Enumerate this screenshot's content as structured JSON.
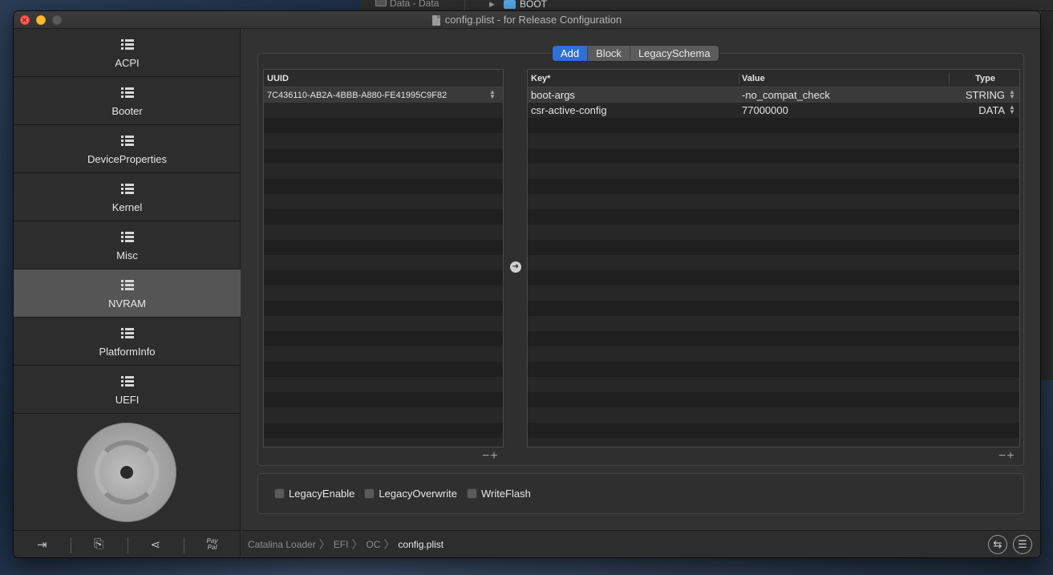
{
  "background": {
    "finder_item": "Data - Data",
    "finder_folder": "BOOT"
  },
  "window": {
    "title": "config.plist - for Release Configuration"
  },
  "sidebar": {
    "items": [
      {
        "label": "ACPI"
      },
      {
        "label": "Booter"
      },
      {
        "label": "DeviceProperties"
      },
      {
        "label": "Kernel"
      },
      {
        "label": "Misc"
      },
      {
        "label": "NVRAM",
        "active": true
      },
      {
        "label": "PlatformInfo"
      },
      {
        "label": "UEFI"
      }
    ],
    "footer": {
      "paypal_line1": "Pay",
      "paypal_line2": "Pal"
    }
  },
  "tabs": [
    "Add",
    "Block",
    "LegacySchema"
  ],
  "active_tab": "Add",
  "uuid_table": {
    "header": "UUID",
    "rows": [
      "7C436110-AB2A-4BBB-A880-FE41995C9F82"
    ]
  },
  "kv_table": {
    "headers": {
      "key": "Key*",
      "value": "Value",
      "type": "Type"
    },
    "rows": [
      {
        "key": "boot-args",
        "value": "-no_compat_check",
        "type": "STRING"
      },
      {
        "key": "csr-active-config",
        "value": "77000000",
        "type": "DATA"
      }
    ]
  },
  "plus_minus": "−+",
  "options": [
    {
      "label": "LegacyEnable",
      "checked": false
    },
    {
      "label": "LegacyOverwrite",
      "checked": false
    },
    {
      "label": "WriteFlash",
      "checked": false
    }
  ],
  "breadcrumb": [
    "Catalina Loader",
    "EFI",
    "OC",
    "config.plist"
  ],
  "colors": {
    "accent": "#2f6fd8",
    "sidebar_active": "#555555",
    "close": "#fe5f57",
    "minimize": "#febc2e"
  }
}
